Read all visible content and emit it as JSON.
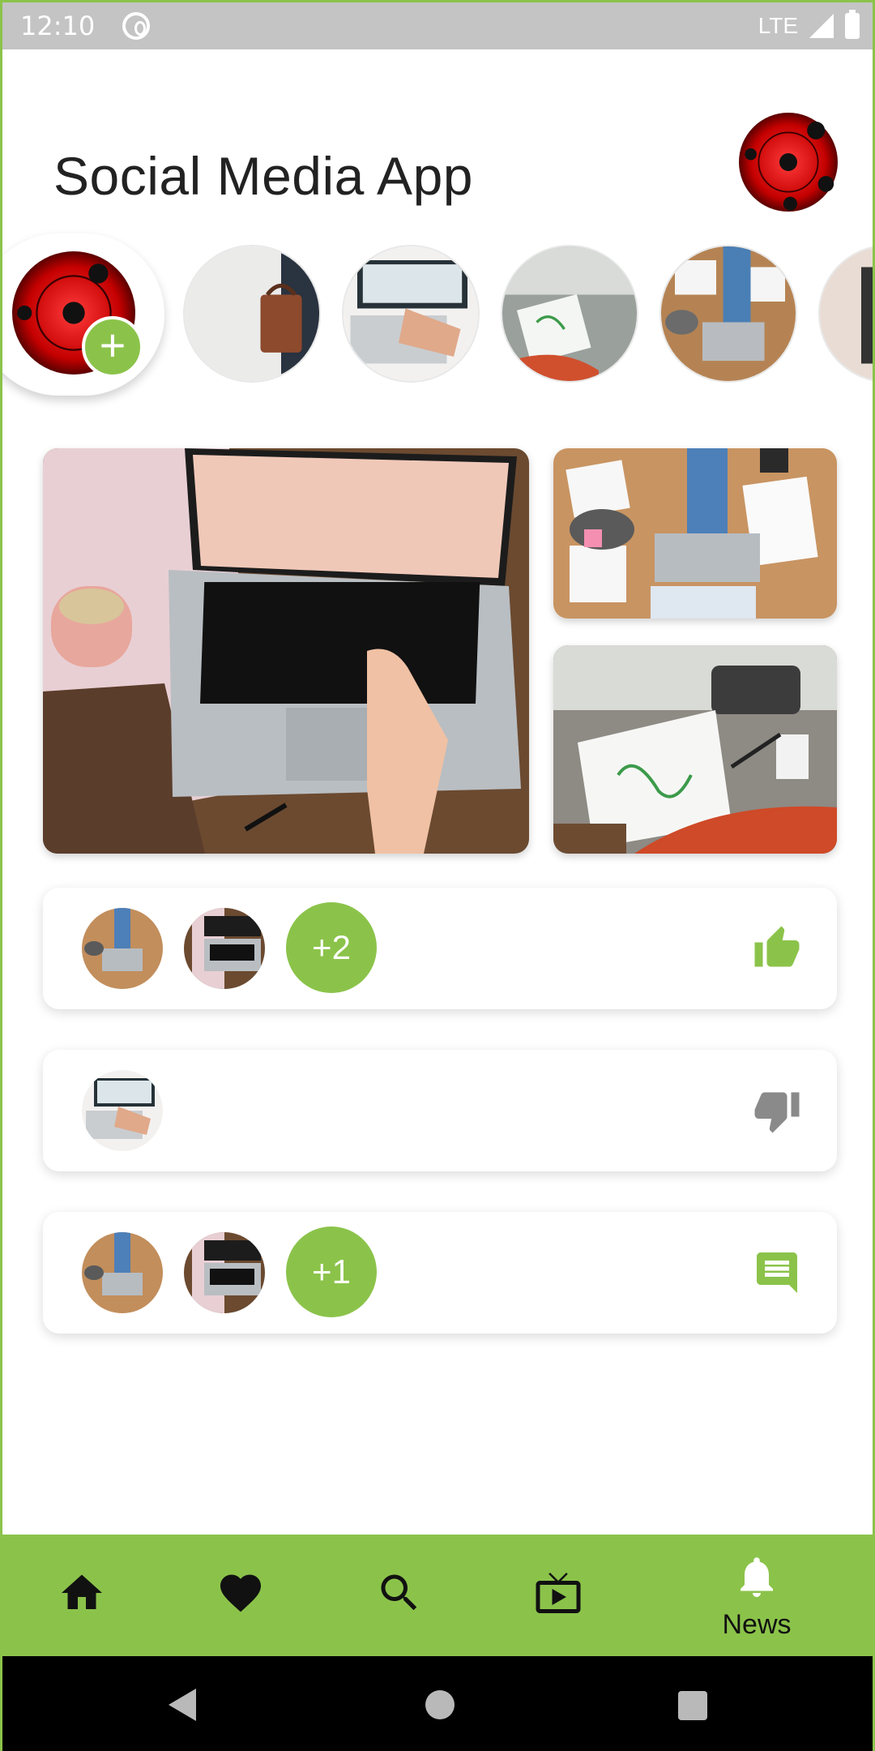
{
  "status_bar": {
    "time": "12:10",
    "network": "LTE"
  },
  "header": {
    "title": "Social Media App"
  },
  "stories": {
    "add_label": "+"
  },
  "activity": [
    {
      "type": "likes",
      "extra_count": "+2",
      "icon": "thumb-up-icon"
    },
    {
      "type": "dislikes",
      "extra_count": "",
      "icon": "thumb-down-icon"
    },
    {
      "type": "comments",
      "extra_count": "+1",
      "icon": "comment-icon"
    }
  ],
  "bottom_nav": {
    "items": [
      {
        "icon": "home-icon",
        "label": ""
      },
      {
        "icon": "heart-icon",
        "label": ""
      },
      {
        "icon": "search-icon",
        "label": ""
      },
      {
        "icon": "live-tv-icon",
        "label": ""
      },
      {
        "icon": "bell-icon",
        "label": "News"
      }
    ]
  },
  "colors": {
    "accent": "#8bc34a",
    "sharingan_red": "#d32f2f",
    "dislike_gray": "#8a8a8a"
  }
}
